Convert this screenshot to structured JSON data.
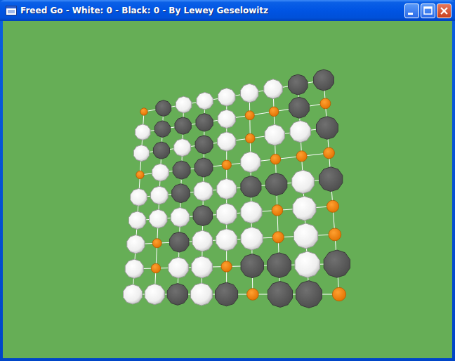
{
  "window": {
    "title": "Freed Go - White: 0 - Black: 0 - By Lewey Geselowitz"
  },
  "board": {
    "rows": [
      [
        "empty",
        "black",
        "white",
        "white",
        "white",
        "white",
        "white",
        "black",
        "black"
      ],
      [
        "white",
        "black",
        "black",
        "black",
        "white",
        "empty",
        "empty",
        "black",
        "empty"
      ],
      [
        "white",
        "black",
        "white",
        "black",
        "white",
        "empty",
        "white",
        "white",
        "black"
      ],
      [
        "empty",
        "white",
        "black",
        "black",
        "empty",
        "white",
        "empty",
        "empty",
        "empty"
      ],
      [
        "white",
        "white",
        "black",
        "white",
        "white",
        "black",
        "black",
        "white",
        "black"
      ],
      [
        "white",
        "white",
        "white",
        "black",
        "white",
        "white",
        "empty",
        "white",
        "empty"
      ],
      [
        "white",
        "empty",
        "black",
        "white",
        "white",
        "white",
        "empty",
        "white",
        "empty"
      ],
      [
        "white",
        "empty",
        "white",
        "white",
        "empty",
        "black",
        "black",
        "white",
        "black"
      ],
      [
        "white",
        "white",
        "black",
        "white",
        "black",
        "empty",
        "black",
        "black",
        "empty"
      ]
    ]
  }
}
